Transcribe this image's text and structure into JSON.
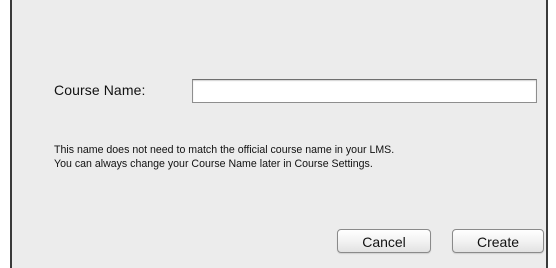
{
  "form": {
    "course_name_label": "Course Name:",
    "course_name_value": "",
    "help_line_1": "This name does not need to match the official course name in your LMS.",
    "help_line_2": "You can always change your Course Name later in Course Settings."
  },
  "buttons": {
    "cancel_label": "Cancel",
    "create_label": "Create"
  },
  "colors": {
    "dialog_background": "#ececec",
    "dialog_border": "#3a3a3a",
    "input_background": "#ffffff"
  }
}
